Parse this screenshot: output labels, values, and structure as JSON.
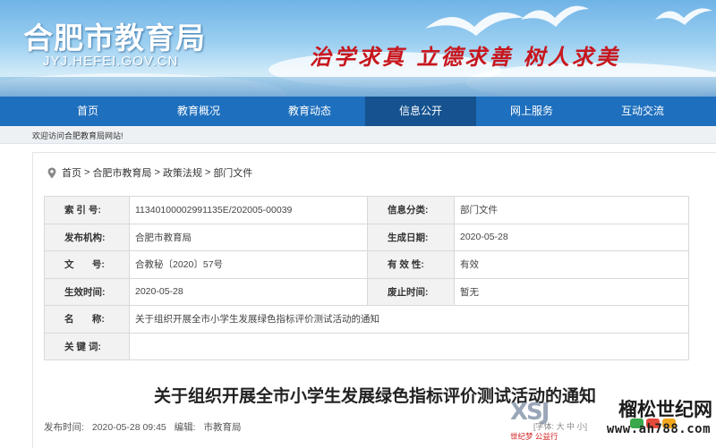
{
  "header": {
    "site_title": "合肥市教育局",
    "site_url": "JYJ.HEFEI.GOV.CN",
    "slogan": "治学求真  立德求善  树人求美",
    "colors": {
      "nav": "#1e6fbd",
      "nav_active": "#15528f",
      "slogan": "#c8161d"
    }
  },
  "nav": {
    "items": [
      {
        "label": "首页"
      },
      {
        "label": "教育概况"
      },
      {
        "label": "教育动态"
      },
      {
        "label": "信息公开"
      },
      {
        "label": "网上服务"
      },
      {
        "label": "互动交流"
      }
    ],
    "active_index": 3
  },
  "welcome": {
    "text": "欢迎访问合肥教育局网站!"
  },
  "breadcrumb": {
    "icon": "location-pin-icon",
    "items": [
      "首页",
      "合肥市教育局",
      "政策法规",
      "部门文件"
    ],
    "separator": ">"
  },
  "meta": {
    "index_no_label": "索 引 号:",
    "index_no": "11340100002991135E/202005-00039",
    "category_label": "信息分类:",
    "category": "部门文件",
    "issuer_label": "发布机构:",
    "issuer": "合肥市教育局",
    "created_label": "生成日期:",
    "created": "2020-05-28",
    "doc_no_label": "文       号:",
    "doc_no": "合教秘〔2020〕57号",
    "validity_label": "有 效 性:",
    "validity": "有效",
    "effective_label": "生效时间:",
    "effective": "2020-05-28",
    "abolish_label": "废止时间:",
    "abolish": "暂无",
    "name_label": "名       称:",
    "name": "关于组织开展全市小学生发展绿色指标评价测试活动的通知",
    "keywords_label": "关 键 词:",
    "keywords": ""
  },
  "article": {
    "title": "关于组织开展全市小学生发展绿色指标评价测试活动的通知",
    "published_label": "发布时间:",
    "published": "2020-05-28 09:45",
    "editor_label": "编辑:",
    "editor": "市教育局"
  },
  "watermark": {
    "left_logo": "XSJ",
    "font_size_label": "[字体: 大 中 小]",
    "left_tag": "世纪梦 公益行",
    "right_name": "榴松世纪网",
    "right_url": "www.ah788.com"
  }
}
